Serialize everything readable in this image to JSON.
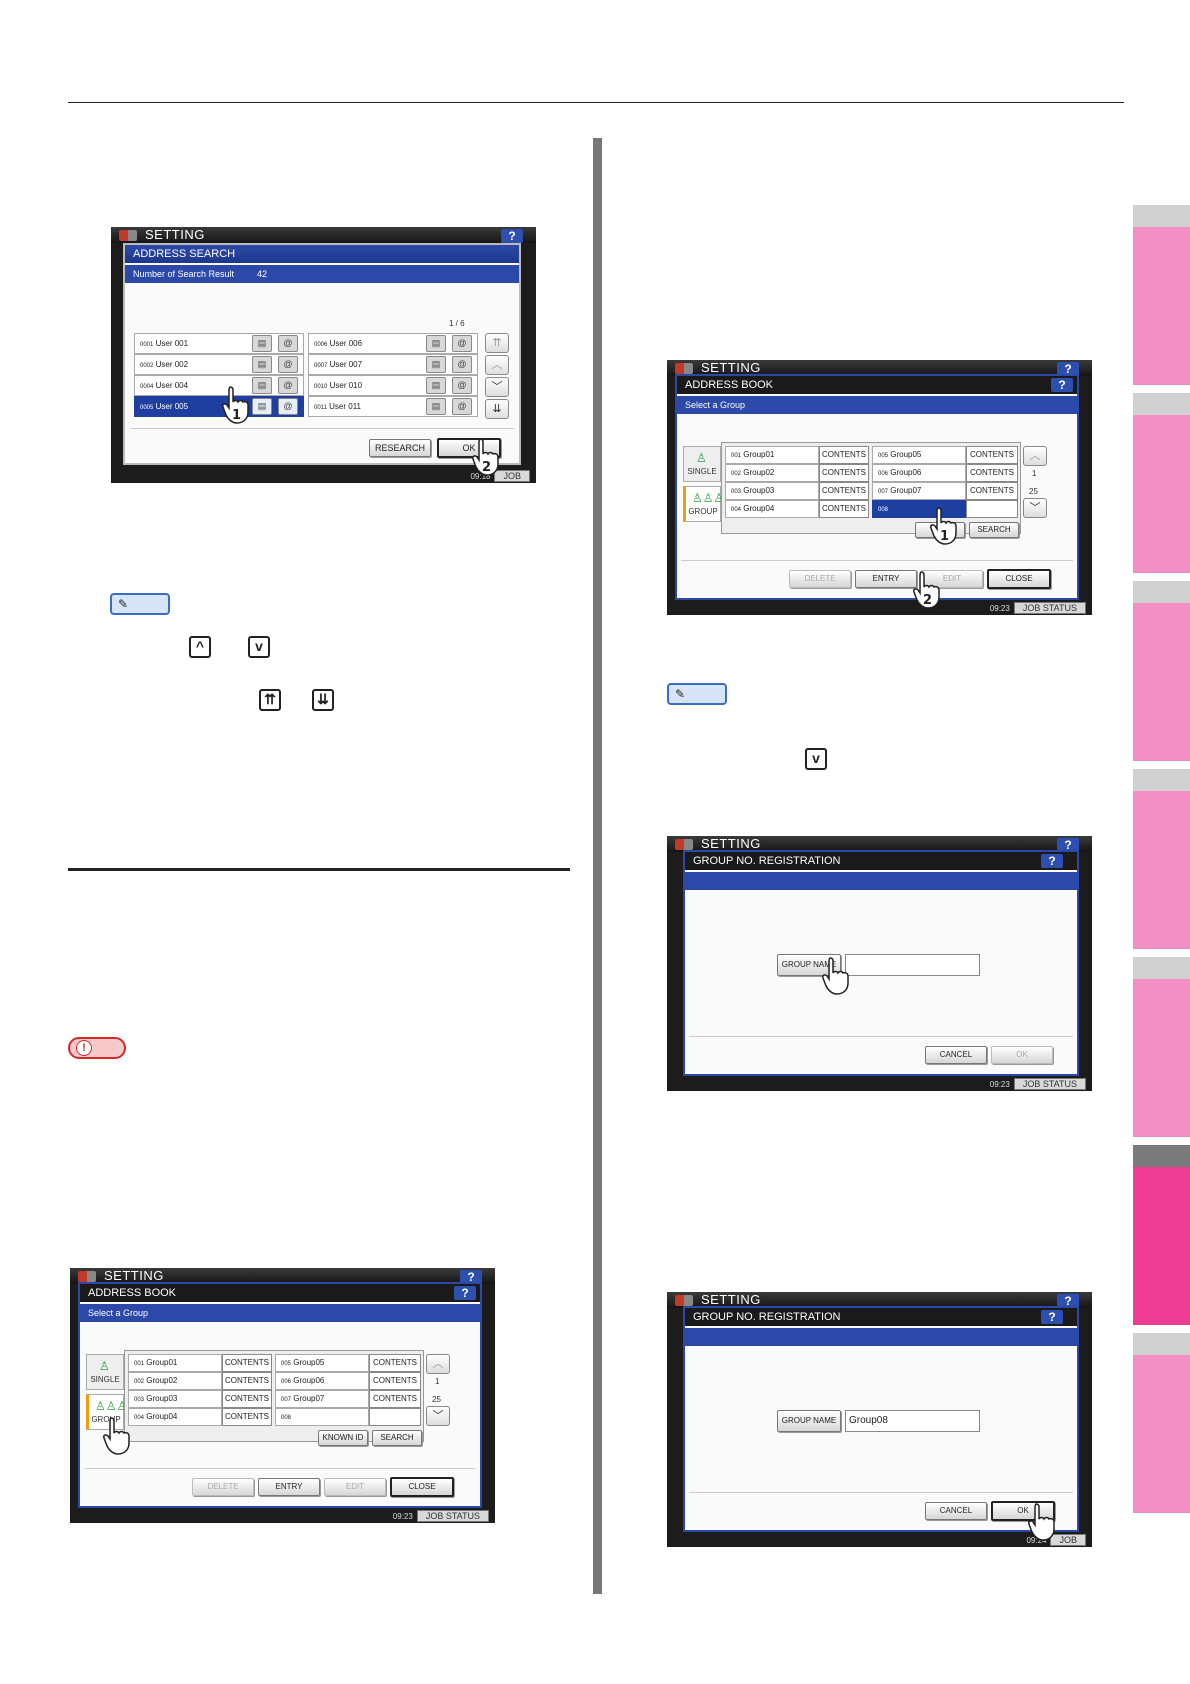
{
  "side_tabs": [
    {
      "active": false
    },
    {
      "active": false
    },
    {
      "active": false
    },
    {
      "active": false
    },
    {
      "active": false
    },
    {
      "active": true
    },
    {
      "active": false
    }
  ],
  "icons": {
    "up": "chevron-up-icon",
    "down": "chevron-down-icon",
    "page_up": "double-chevron-up-icon",
    "page_down": "double-chevron-down-icon",
    "memo": "memo-icon",
    "note": "warning-note-icon",
    "hand": "pointing-hand-icon"
  },
  "colors": {
    "accent": "#ee3d95",
    "tab": "#f28fc2",
    "blue": "#2c49a9",
    "selected": "#1e3ea0"
  },
  "panel1": {
    "title": "SETTING",
    "help": "?",
    "dialog_title": "ADDRESS SEARCH",
    "result_label": "Number of Search Result",
    "result_count": "42",
    "page": "1  /  6",
    "rows_left": [
      {
        "no": "0001",
        "name": "User  001"
      },
      {
        "no": "0002",
        "name": "User  002"
      },
      {
        "no": "0004",
        "name": "User  004"
      },
      {
        "no": "0005",
        "name": "User  005"
      }
    ],
    "rows_right": [
      {
        "no": "0006",
        "name": "User  006"
      },
      {
        "no": "0007",
        "name": "User  007"
      },
      {
        "no": "0010",
        "name": "User  010"
      },
      {
        "no": "0011",
        "name": "User  011"
      }
    ],
    "research": "RESEARCH",
    "ok": "OK",
    "clock": "09:18",
    "job_status": "JOB",
    "step1": "1",
    "step2": "2"
  },
  "panel_group": {
    "title": "SETTING",
    "help": "?",
    "dialog_title": "ADDRESS BOOK",
    "sub": "Select a Group",
    "single": "SINGLE",
    "group": "GROUP",
    "left": [
      {
        "no": "001",
        "name": "Group01",
        "c": "CONTENTS"
      },
      {
        "no": "002",
        "name": "Group02",
        "c": "CONTENTS"
      },
      {
        "no": "003",
        "name": "Group03",
        "c": "CONTENTS"
      },
      {
        "no": "004",
        "name": "Group04",
        "c": "CONTENTS"
      }
    ],
    "right": [
      {
        "no": "005",
        "name": "Group05",
        "c": "CONTENTS"
      },
      {
        "no": "006",
        "name": "Group06",
        "c": "CONTENTS"
      },
      {
        "no": "007",
        "name": "Group07",
        "c": "CONTENTS"
      },
      {
        "no": "008",
        "name": "",
        "c": ""
      }
    ],
    "page_top": "1",
    "page_bottom": "25",
    "known_id": "KNOWN ID",
    "search": "SEARCH",
    "delete": "DELETE",
    "entry": "ENTRY",
    "edit": "EDIT",
    "close": "CLOSE",
    "clock": "09:23",
    "job_status": "JOB STATUS",
    "known_id_short": "NID"
  },
  "panel_reg": {
    "title": "SETTING",
    "help": "?",
    "dialog_title": "GROUP NO. REGISTRATION",
    "group_name": "GROUP NAME",
    "cancel": "CANCEL",
    "ok": "OK",
    "value_empty": "",
    "value_filled": "Group08",
    "clock_a": "09:23",
    "clock_b": "09:24",
    "job_status": "JOB STATUS",
    "job_short": "JOB"
  }
}
